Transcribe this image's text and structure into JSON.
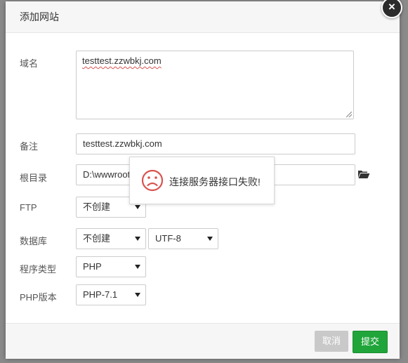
{
  "dialog": {
    "title": "添加网站",
    "close_symbol": "×"
  },
  "form": {
    "domain_label": "域名",
    "domain_value": "testtest.zzwbkj.com",
    "remark_label": "备注",
    "remark_value": "testtest.zzwbkj.com",
    "root_label": "根目录",
    "root_value": "D:\\wwwroot\\",
    "ftp_label": "FTP",
    "ftp_value": "不创建",
    "db_label": "数据库",
    "db_value": "不创建",
    "charset_value": "UTF-8",
    "program_label": "程序类型",
    "program_value": "PHP",
    "php_label": "PHP版本",
    "php_value": "PHP-7.1"
  },
  "toast": {
    "message": "连接服务器接口失败!",
    "icon": "sad-face-icon"
  },
  "footer": {
    "cancel_label": "取消",
    "submit_label": "提交"
  },
  "colors": {
    "submit": "#20a53a",
    "cancel": "#c9c9c9",
    "error_icon": "#d9534f"
  }
}
